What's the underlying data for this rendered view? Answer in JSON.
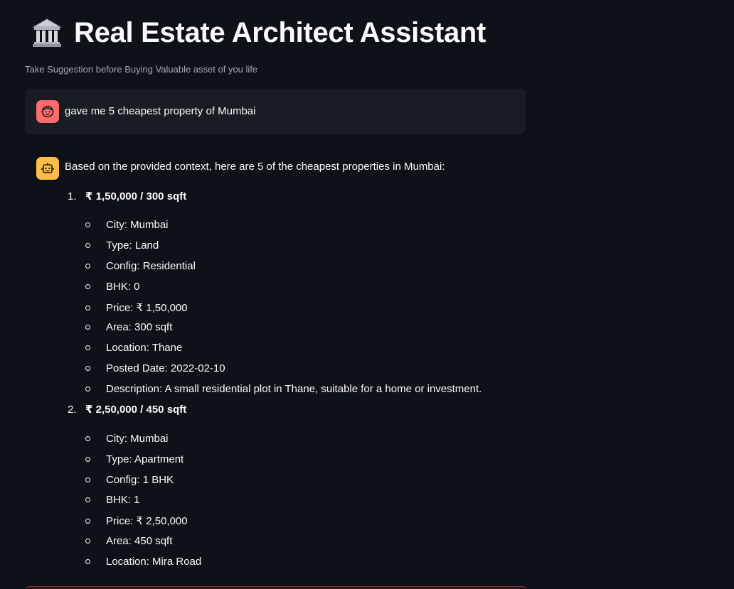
{
  "app": {
    "title": "Real Estate Architect Assistant",
    "subtitle": "Take Suggestion before Buying Valuable asset of you life",
    "title_icon": "classical-building-icon"
  },
  "user_message": {
    "avatar_icon": "face-icon",
    "avatar_color": "#ff6b6b",
    "text": "gave me 5 cheapest property of Mumbai"
  },
  "assistant_message": {
    "avatar_icon": "robot-icon",
    "avatar_color": "#ffbd45",
    "intro": "Based on the provided context, here are 5 of the cheapest properties in Mumbai:",
    "items": [
      {
        "number": "1.",
        "title": "₹ 1,50,000 / 300 sqft",
        "details": [
          "City: Mumbai",
          "Type: Land",
          "Config: Residential",
          "BHK: 0",
          "Price: ₹ 1,50,000",
          "Area: 300 sqft",
          "Location: Thane",
          "Posted Date: 2022-02-10",
          "Description: A small residential plot in Thane, suitable for a home or investment."
        ]
      },
      {
        "number": "2.",
        "title": "₹ 2,50,000 / 450 sqft",
        "details": [
          "City: Mumbai",
          "Type: Apartment",
          "Config: 1 BHK",
          "BHK: 1",
          "Price: ₹ 2,50,000",
          "Area: 450 sqft",
          "Location: Mira Road"
        ]
      }
    ]
  },
  "colors": {
    "background": "#0e1117",
    "user_bubble": "#1a1c24",
    "text": "#fafafa",
    "muted_text": "#a3a8b8"
  }
}
